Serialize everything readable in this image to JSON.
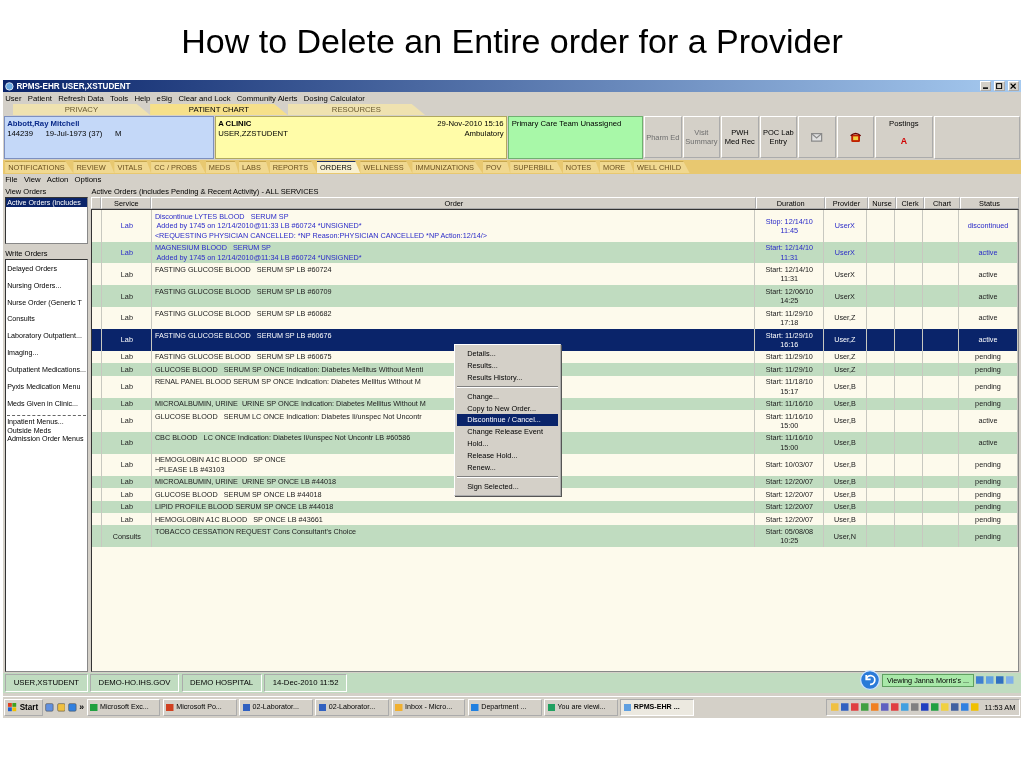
{
  "slide": {
    "title": "How to Delete an Entire order for a Provider"
  },
  "window": {
    "title": "RPMS-EHR USER,XSTUDENT"
  },
  "menu": [
    "User",
    "Patient",
    "Refresh Data",
    "Tools",
    "Help",
    "eSig",
    "Clear and Lock",
    "Community Alerts",
    "Dosing Calculator"
  ],
  "top_tabs": [
    {
      "label": "PRIVACY",
      "selected": false
    },
    {
      "label": "PATIENT CHART",
      "selected": true
    },
    {
      "label": "RESOURCES",
      "selected": false
    }
  ],
  "patient": {
    "name": "Abbott,Ray Mitchell",
    "id": "144239",
    "dob": "19-Jul-1973 (37)",
    "sex": "M"
  },
  "visit": {
    "location": "A CLINIC",
    "provider": "USER,ZZSTUDENT",
    "date": "29-Nov-2010 15:16",
    "type": "Ambulatory"
  },
  "care_team": "Primary Care Team Unassigned",
  "header_buttons": [
    {
      "kind": "text",
      "label": "Pharm Ed",
      "disabled": true
    },
    {
      "kind": "text",
      "label": "Visit Summary",
      "disabled": true
    },
    {
      "kind": "text",
      "label": "PWH Med Rec",
      "disabled": false
    },
    {
      "kind": "text",
      "label": "POC Lab Entry",
      "disabled": false
    },
    {
      "kind": "mail",
      "disabled": true
    },
    {
      "kind": "phone",
      "disabled": false
    }
  ],
  "postings": {
    "label": "Postings",
    "value": "A"
  },
  "chart_tabs": [
    {
      "label": "NOTIFICATIONS",
      "selected": false
    },
    {
      "label": "REVIEW",
      "selected": false
    },
    {
      "label": "VITALS",
      "selected": false
    },
    {
      "label": "CC / PROBS",
      "selected": false
    },
    {
      "label": "MEDS",
      "selected": false
    },
    {
      "label": "LABS",
      "selected": false
    },
    {
      "label": "REPORTS",
      "selected": false
    },
    {
      "label": "ORDERS",
      "selected": true
    },
    {
      "label": "WELLNESS",
      "selected": false
    },
    {
      "label": "IMMUNIZATIONS",
      "selected": false
    },
    {
      "label": "POV",
      "selected": false
    },
    {
      "label": "SUPERBILL",
      "selected": false
    },
    {
      "label": "NOTES",
      "selected": false
    },
    {
      "label": "MORE",
      "selected": false
    },
    {
      "label": "WELL CHILD",
      "selected": false
    }
  ],
  "submenu": [
    "File",
    "View",
    "Action",
    "Options"
  ],
  "view_orders": {
    "label": "View Orders",
    "items": [
      {
        "label": "Active Orders (includes",
        "selected": true
      }
    ]
  },
  "write_orders": {
    "label": "Write Orders",
    "groups": [
      [
        "Delayed Orders",
        "Nursing Orders...",
        "Nurse Order (Generic T",
        "Consults",
        "Laboratory Outpatient...",
        "Imaging...",
        "Outpatient Medications...",
        "Pyxis Medication Menu",
        "Meds Given in Clinic..."
      ],
      [
        "Inpatient Menus...",
        "Outside Meds",
        "Admission Order Menus"
      ]
    ]
  },
  "orders": {
    "caption": "Active Orders (includes Pending & Recent Activity) - ALL SERVICES",
    "columns": [
      "Service",
      "Order",
      "Duration",
      "Provider",
      "Nurse",
      "Clerk",
      "Chart",
      "Status"
    ],
    "rows": [
      {
        "service": "Lab",
        "order": [
          "Discontinue LYTES BLOOD   SERUM SP",
          " Added by 1745 on 12/14/2010@11:33 LB #60724 *UNSIGNED*",
          "<REQUESTING PHYSICIAN CANCELLED: *NP Reason:PHYSICIAN CANCELLED *NP Action:12/14/>"
        ],
        "duration": [
          "Stop: 12/14/10",
          "11:45"
        ],
        "provider": "UserX",
        "status": "discontinued",
        "unsigned": true,
        "selected": false
      },
      {
        "service": "Lab",
        "order": [
          "MAGNESIUM BLOOD   SERUM SP",
          " Added by 1745 on 12/14/2010@11:34 LB #60724 *UNSIGNED*"
        ],
        "duration": [
          "Start: 12/14/10",
          "11:31"
        ],
        "provider": "UserX",
        "status": "active",
        "unsigned": true,
        "selected": false
      },
      {
        "service": "Lab",
        "order": [
          "FASTING GLUCOSE BLOOD   SERUM SP LB #60724"
        ],
        "duration": [
          "Start: 12/14/10",
          "11:31"
        ],
        "provider": "UserX",
        "status": "active",
        "unsigned": false,
        "selected": false
      },
      {
        "service": "Lab",
        "order": [
          "FASTING GLUCOSE BLOOD   SERUM SP LB #60709"
        ],
        "duration": [
          "Start: 12/06/10",
          "14:25"
        ],
        "provider": "UserX",
        "status": "active",
        "unsigned": false,
        "selected": false
      },
      {
        "service": "Lab",
        "order": [
          "FASTING GLUCOSE BLOOD   SERUM SP LB #60682"
        ],
        "duration": [
          "Start: 11/29/10",
          "17:18"
        ],
        "provider": "User,Z",
        "status": "active",
        "unsigned": false,
        "selected": false
      },
      {
        "service": "Lab",
        "order": [
          "FASTING GLUCOSE BLOOD   SERUM SP LB #60676"
        ],
        "duration": [
          "Start: 11/29/10",
          "16:16"
        ],
        "provider": "User,Z",
        "status": "active",
        "unsigned": false,
        "selected": true
      },
      {
        "service": "Lab",
        "order": [
          "FASTING GLUCOSE BLOOD   SERUM SP LB #60675"
        ],
        "duration": [
          "Start: 11/29/10"
        ],
        "provider": "User,Z",
        "status": "pending",
        "unsigned": false,
        "selected": false
      },
      {
        "service": "Lab",
        "order": [
          "GLUCOSE BLOOD   SERUM SP ONCE Indication: Diabetes Mellitus Without Menti"
        ],
        "duration": [
          "Start: 11/29/10"
        ],
        "provider": "User,Z",
        "status": "pending",
        "unsigned": false,
        "selected": false
      },
      {
        "service": "Lab",
        "order": [
          "RENAL PANEL BLOOD SERUM SP ONCE Indication: Diabetes Mellitus Without M"
        ],
        "duration": [
          "Start: 11/18/10",
          "15:17"
        ],
        "provider": "User,B",
        "status": "pending",
        "unsigned": false,
        "selected": false
      },
      {
        "service": "Lab",
        "order": [
          "MICROALBUMIN, URINE  URINE SP ONCE Indication: Diabetes Mellitus Without M"
        ],
        "duration": [
          "Start: 11/16/10"
        ],
        "provider": "User,B",
        "status": "pending",
        "unsigned": false,
        "selected": false
      },
      {
        "service": "Lab",
        "order": [
          "GLUCOSE BLOOD   SERUM LC ONCE Indication: Diabetes Ii/unspec Not Uncontr"
        ],
        "duration": [
          "Start: 11/16/10",
          "15:00"
        ],
        "provider": "User,B",
        "status": "active",
        "unsigned": false,
        "selected": false
      },
      {
        "service": "Lab",
        "order": [
          "CBC BLOOD   LC ONCE Indication: Diabetes Ii/unspec Not Uncontr LB #60586"
        ],
        "duration": [
          "Start: 11/16/10",
          "15:00"
        ],
        "provider": "User,B",
        "status": "active",
        "unsigned": false,
        "selected": false
      },
      {
        "service": "Lab",
        "order": [
          "HEMOGLOBIN A1C BLOOD   SP ONCE",
          "~PLEASE LB #43103"
        ],
        "duration": [
          "Start: 10/03/07"
        ],
        "provider": "User,B",
        "status": "pending",
        "unsigned": false,
        "selected": false
      },
      {
        "service": "Lab",
        "order": [
          "MICROALBUMIN, URINE  URINE SP ONCE LB #44018"
        ],
        "duration": [
          "Start: 12/20/07"
        ],
        "provider": "User,B",
        "status": "pending",
        "unsigned": false,
        "selected": false
      },
      {
        "service": "Lab",
        "order": [
          "GLUCOSE BLOOD   SERUM SP ONCE LB #44018"
        ],
        "duration": [
          "Start: 12/20/07"
        ],
        "provider": "User,B",
        "status": "pending",
        "unsigned": false,
        "selected": false
      },
      {
        "service": "Lab",
        "order": [
          "LIPID PROFILE BLOOD SERUM SP ONCE LB #44018"
        ],
        "duration": [
          "Start: 12/20/07"
        ],
        "provider": "User,B",
        "status": "pending",
        "unsigned": false,
        "selected": false
      },
      {
        "service": "Lab",
        "order": [
          "HEMOGLOBIN A1C BLOOD   SP ONCE LB #43661"
        ],
        "duration": [
          "Start: 12/20/07"
        ],
        "provider": "User,B",
        "status": "pending",
        "unsigned": false,
        "selected": false
      },
      {
        "service": "Consults",
        "order": [
          "TOBACCO CESSATION REQUEST Cons Consultant's Choice"
        ],
        "duration": [
          "Start: 05/08/08",
          "10:25"
        ],
        "provider": "User,N",
        "status": "pending",
        "unsigned": false,
        "selected": false
      }
    ]
  },
  "context_menu": {
    "groups": [
      [
        {
          "label": "Details...",
          "selected": false
        },
        {
          "label": "Results...",
          "selected": false
        },
        {
          "label": "Results History...",
          "selected": false
        }
      ],
      [
        {
          "label": "Change...",
          "selected": false
        },
        {
          "label": "Copy to New Order...",
          "selected": false
        },
        {
          "label": "Discontinue / Cancel...",
          "selected": true
        },
        {
          "label": "Change Release Event",
          "selected": false
        },
        {
          "label": "Hold...",
          "selected": false
        },
        {
          "label": "Release Hold...",
          "selected": false
        },
        {
          "label": "Renew...",
          "selected": false
        }
      ],
      [
        {
          "label": "Sign Selected...",
          "selected": false
        }
      ]
    ]
  },
  "status_bar": [
    "USER,XSTUDENT",
    "DEMO-HO.IHS.GOV",
    "DEMO HOSPITAL",
    "14-Dec-2010 11:52"
  ],
  "notification": {
    "text": "Viewing Janna Morris's ..."
  },
  "taskbar": {
    "start": "Start",
    "more": "»",
    "tasks": [
      {
        "label": "Microsoft Exc...",
        "selected": false
      },
      {
        "label": "Microsoft Po...",
        "selected": false
      },
      {
        "label": "02-Laborator...",
        "selected": false
      },
      {
        "label": "02-Laborator...",
        "selected": false
      },
      {
        "label": "Inbox - Micro...",
        "selected": false
      },
      {
        "label": "Department ...",
        "selected": false
      },
      {
        "label": "You are viewi...",
        "selected": false
      },
      {
        "label": "RPMS-EHR ...",
        "selected": true
      }
    ],
    "clock": "11:53 AM"
  }
}
